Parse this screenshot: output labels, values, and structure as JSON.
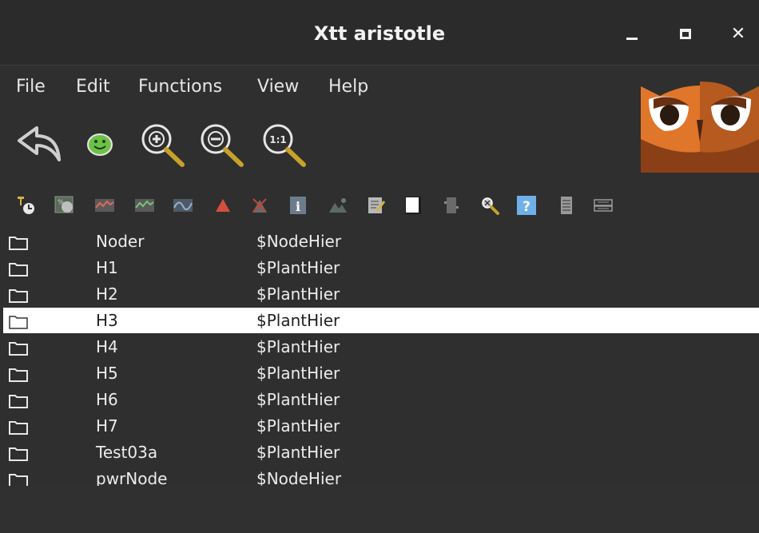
{
  "window": {
    "title": "Xtt aristotle"
  },
  "menu": {
    "items": [
      "File",
      "Edit",
      "Functions",
      "View",
      "Help"
    ]
  },
  "toolbar": {
    "big_icons": [
      "back-arrow-icon",
      "smiley-icon",
      "zoom-in-icon",
      "zoom-out-icon",
      "zoom-reset-icon"
    ],
    "small_icons": [
      "trend-object-icon",
      "trend-graph-icon",
      "curve-red-icon",
      "curve-green-icon",
      "curve-blue-icon",
      "alarm-triangle-icon",
      "block-icon",
      "info-icon",
      "landscape-icon",
      "note-icon",
      "blank-page-icon",
      "object-icon",
      "search-icon",
      "help-icon",
      "document-icon",
      "crossref-icon"
    ]
  },
  "list": {
    "rows": [
      {
        "name": "Noder",
        "class": "$NodeHier"
      },
      {
        "name": "H1",
        "class": "$PlantHier"
      },
      {
        "name": "H2",
        "class": "$PlantHier"
      },
      {
        "name": "H3",
        "class": "$PlantHier"
      },
      {
        "name": "H4",
        "class": "$PlantHier"
      },
      {
        "name": "H5",
        "class": "$PlantHier"
      },
      {
        "name": "H6",
        "class": "$PlantHier"
      },
      {
        "name": "H7",
        "class": "$PlantHier"
      },
      {
        "name": "Test03a",
        "class": "$PlantHier"
      },
      {
        "name": "pwrNode",
        "class": "$NodeHier"
      }
    ],
    "selected_index": 3
  },
  "colors": {
    "selection": "#ffffff",
    "background": "#2f2f2f",
    "title_bar": "#2b2b2b"
  }
}
